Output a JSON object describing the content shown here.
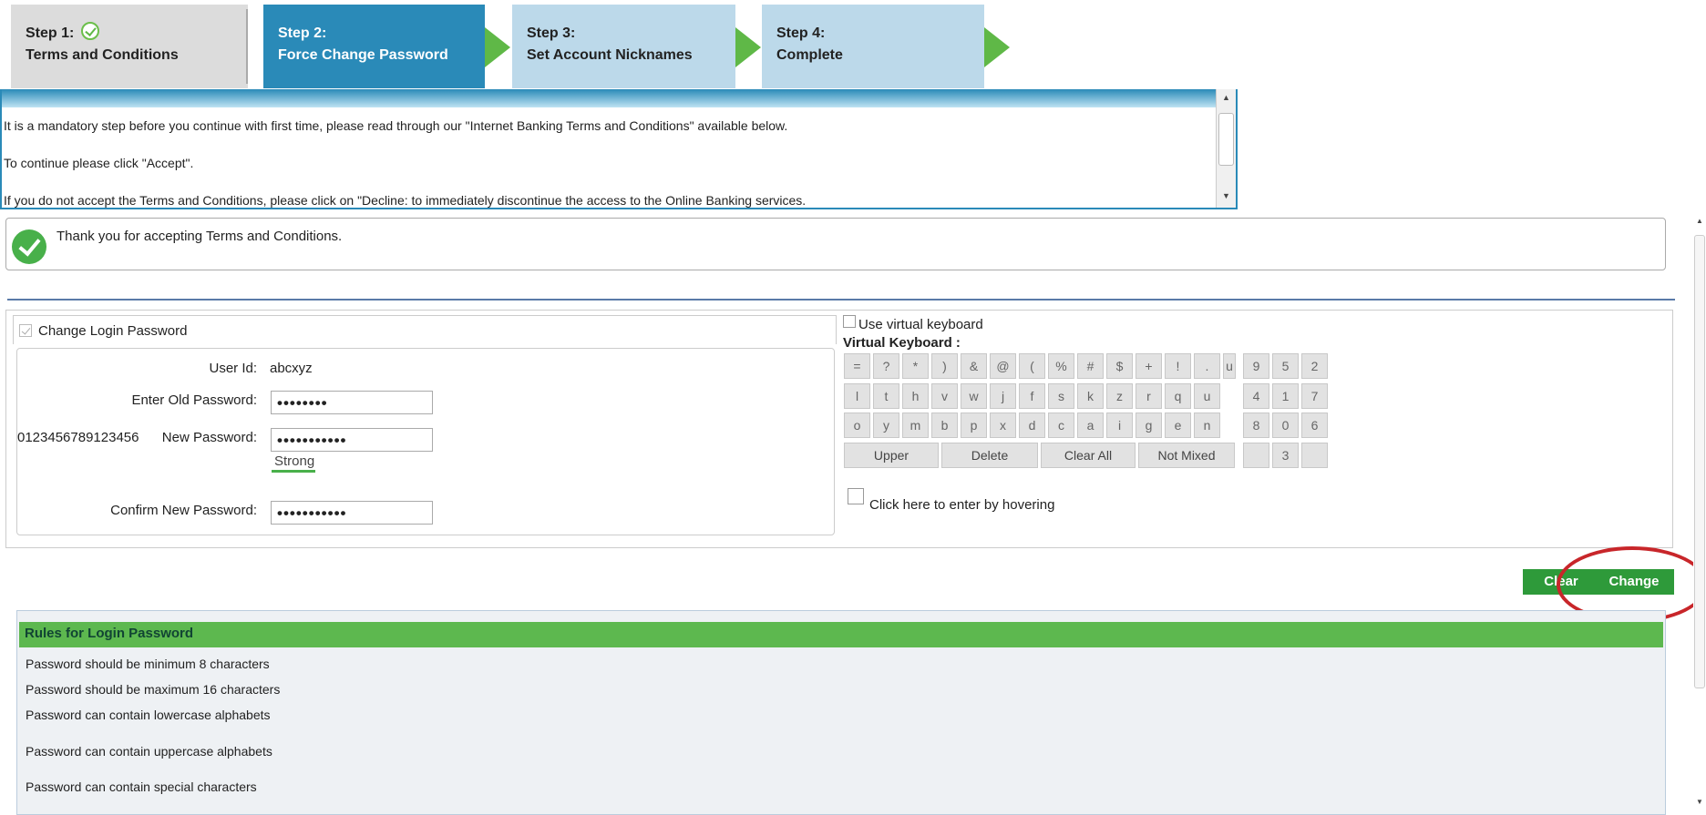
{
  "steps": [
    {
      "num": "Step 1:",
      "title": "Terms and Conditions"
    },
    {
      "num": "Step 2:",
      "title": "Force Change Password"
    },
    {
      "num": "Step 3:",
      "title": "Set Account Nicknames"
    },
    {
      "num": "Step 4:",
      "title": "Complete"
    }
  ],
  "terms": {
    "line1": "It is a mandatory step before you continue with first time, please read through our \"Internet Banking Terms and Conditions\" available below.",
    "line2": "To continue please click \"Accept\".",
    "line3": "If you do not accept the Terms and Conditions, please click on \"Decline: to immediately discontinue the access to the Online Banking services."
  },
  "success": {
    "message": "Thank you for accepting Terms and Conditions."
  },
  "form": {
    "change_login_label": "Change Login Password",
    "user_id_label": "User Id:",
    "user_id_value": "abcxyz",
    "old_password_label": "Enter Old Password:",
    "old_password_value": "••••••••",
    "new_password_label": "New Password:",
    "new_password_value": "•••••••••••",
    "overlay_text": "0123456789123456",
    "strength_label": "Strong",
    "confirm_password_label": "Confirm New Password:",
    "confirm_password_value": "•••••••••••"
  },
  "keyboard": {
    "use_label": "Use virtual keyboard",
    "title": "Virtual Keyboard :",
    "row1": [
      "=",
      "?",
      "*",
      ")",
      "&",
      "@",
      "(",
      "%",
      "#",
      "$",
      "+",
      "!",
      ".",
      "u"
    ],
    "row2": [
      "l",
      "t",
      "h",
      "v",
      "w",
      "j",
      "f",
      "s",
      "k",
      "z",
      "r",
      "q",
      "u"
    ],
    "row3": [
      "o",
      "y",
      "m",
      "b",
      "p",
      "x",
      "d",
      "c",
      "a",
      "i",
      "g",
      "e",
      "n"
    ],
    "num1": [
      "9",
      "5",
      "2"
    ],
    "num2": [
      "4",
      "1",
      "7"
    ],
    "num3": [
      "8",
      "0",
      "6"
    ],
    "num4": [
      "",
      "3",
      ""
    ],
    "upper": "Upper",
    "delete": "Delete",
    "clear_all": "Clear All",
    "not_mixed": "Not Mixed",
    "hover_label": "Click here to enter by hovering"
  },
  "buttons": {
    "clear": "Clear",
    "change": "Change"
  },
  "rules": {
    "title": "Rules for Login Password",
    "items": [
      "Password should be minimum 8 characters",
      "Password should be maximum 16 characters",
      "Password can contain lowercase alphabets",
      "Password can contain uppercase alphabets",
      "Password can contain special characters"
    ]
  }
}
